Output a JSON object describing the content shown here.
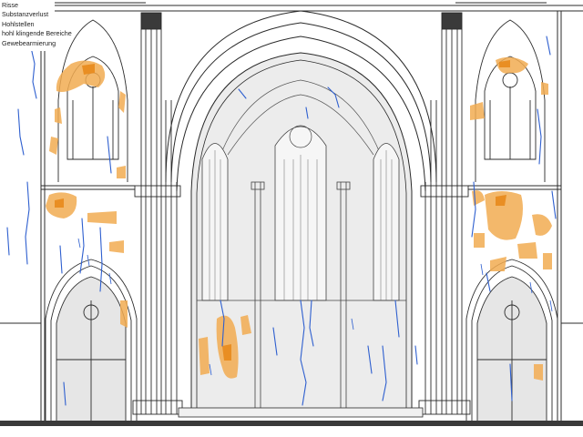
{
  "legend": {
    "items": [
      {
        "label": "Risse"
      },
      {
        "label": "Substanzverlust"
      },
      {
        "label": "Hohlstellen"
      },
      {
        "label": "hohl klingende Bereiche"
      },
      {
        "label": "Gewebearmierung"
      }
    ]
  },
  "colors": {
    "line": "#2b2b2b",
    "wall": "#ffffff",
    "choir_fill": "#ececec",
    "crack": "#2e5fcf",
    "hollow": "#f2ac52",
    "hollow_core": "#e8891c",
    "ground": "#3a3a3a"
  }
}
